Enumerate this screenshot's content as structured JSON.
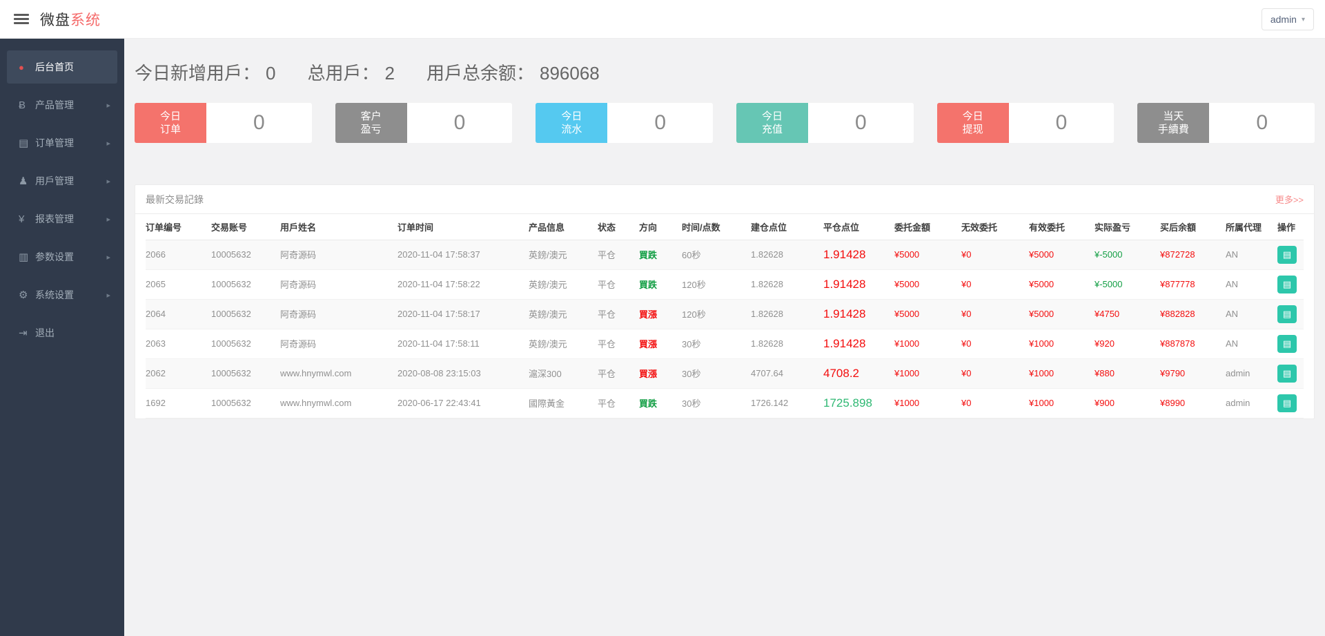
{
  "topbar": {
    "logo_black": "微盘",
    "logo_red": "系统",
    "user_menu": {
      "label": "admin",
      "caret": "▾"
    }
  },
  "sidebar": {
    "items": [
      {
        "name": "sidebar-item-dashboard",
        "icon_name": "dashboard-icon",
        "icon_glyph": "●",
        "label": "后台首页",
        "chevron": "",
        "state": "active"
      },
      {
        "name": "sidebar-item-products",
        "icon_name": "bitcoin-icon",
        "icon_glyph": "Ƀ",
        "label": "产品管理",
        "chevron": "▸"
      },
      {
        "name": "sidebar-item-orders",
        "icon_name": "files-icon",
        "icon_glyph": "▤",
        "label": "订单管理",
        "chevron": "▸"
      },
      {
        "name": "sidebar-item-users",
        "icon_name": "user-icon",
        "icon_glyph": "♟",
        "label": "用戶管理",
        "chevron": "▸"
      },
      {
        "name": "sidebar-item-reports",
        "icon_name": "yen-icon",
        "icon_glyph": "¥",
        "label": "报表管理",
        "chevron": "▸"
      },
      {
        "name": "sidebar-item-params",
        "icon_name": "copy-icon",
        "icon_glyph": "▥",
        "label": "参数设置",
        "chevron": "▸"
      },
      {
        "name": "sidebar-item-system",
        "icon_name": "gears-icon",
        "icon_glyph": "⚙",
        "label": "系统设置",
        "chevron": "▸"
      },
      {
        "name": "sidebar-item-logout",
        "icon_name": "signout-icon",
        "icon_glyph": "⇥",
        "label": "退出",
        "chevron": ""
      }
    ]
  },
  "stats": [
    {
      "label": "今日新增用戶：",
      "value": "0"
    },
    {
      "label": "总用戶：",
      "value": "2"
    },
    {
      "label": "用戶总余额：",
      "value": "896068"
    }
  ],
  "cards": [
    {
      "name": "card-today-orders",
      "label": "今日\n订单",
      "value": "0",
      "color": "#f4736c"
    },
    {
      "name": "card-client-pnl",
      "label": "客户\n盈亏",
      "value": "0",
      "color": "#8e8e8e"
    },
    {
      "name": "card-today-flow",
      "label": "今日\n流水",
      "value": "0",
      "color": "#55c9f0"
    },
    {
      "name": "card-today-deposit",
      "label": "今日\n充值",
      "value": "0",
      "color": "#66c6b4"
    },
    {
      "name": "card-today-withdraw",
      "label": "今日\n提现",
      "value": "0",
      "color": "#f4736c"
    },
    {
      "name": "card-today-fees",
      "label": "当天\n手續費",
      "value": "0",
      "color": "#8e8e8e"
    }
  ],
  "panel": {
    "title": "最新交易記錄",
    "more_label": "更多>>",
    "action_icon": "▤",
    "headers": [
      "订单编号",
      "交易账号",
      "用戶姓名",
      "订单时间",
      "产品信息",
      "状态",
      "方向",
      "时间/点数",
      "建仓点位",
      "平仓点位",
      "委托金額",
      "无效委托",
      "有效委托",
      "实际盈亏",
      "买后余額",
      "所属代理",
      "操作"
    ],
    "rows": [
      {
        "id": "2066",
        "account": "10005632",
        "name": "阿奇源码",
        "time": "2020-11-04 17:58:37",
        "product": "英鎊/澳元",
        "status": "平仓",
        "dir": "買跌",
        "dir_c": "green",
        "period": "60秒",
        "open": "1.82628",
        "close": "1.91428",
        "close_c": "red",
        "amount": "¥5000",
        "invalid": "¥0",
        "valid": "¥5000",
        "profit": "¥-5000",
        "profit_c": "green",
        "balance": "¥872728",
        "agent": "AN"
      },
      {
        "id": "2065",
        "account": "10005632",
        "name": "阿奇源码",
        "time": "2020-11-04 17:58:22",
        "product": "英鎊/澳元",
        "status": "平仓",
        "dir": "買跌",
        "dir_c": "green",
        "period": "120秒",
        "open": "1.82628",
        "close": "1.91428",
        "close_c": "red",
        "amount": "¥5000",
        "invalid": "¥0",
        "valid": "¥5000",
        "profit": "¥-5000",
        "profit_c": "green",
        "balance": "¥877778",
        "agent": "AN"
      },
      {
        "id": "2064",
        "account": "10005632",
        "name": "阿奇源码",
        "time": "2020-11-04 17:58:17",
        "product": "英鎊/澳元",
        "status": "平仓",
        "dir": "買漲",
        "dir_c": "red",
        "period": "120秒",
        "open": "1.82628",
        "close": "1.91428",
        "close_c": "red",
        "amount": "¥5000",
        "invalid": "¥0",
        "valid": "¥5000",
        "profit": "¥4750",
        "profit_c": "red",
        "balance": "¥882828",
        "agent": "AN"
      },
      {
        "id": "2063",
        "account": "10005632",
        "name": "阿奇源码",
        "time": "2020-11-04 17:58:11",
        "product": "英鎊/澳元",
        "status": "平仓",
        "dir": "買漲",
        "dir_c": "red",
        "period": "30秒",
        "open": "1.82628",
        "close": "1.91428",
        "close_c": "red",
        "amount": "¥1000",
        "invalid": "¥0",
        "valid": "¥1000",
        "profit": "¥920",
        "profit_c": "red",
        "balance": "¥887878",
        "agent": "AN"
      },
      {
        "id": "2062",
        "account": "10005632",
        "name": "www.hnymwl.com",
        "time": "2020-08-08 23:15:03",
        "product": "滬深300",
        "status": "平仓",
        "dir": "買漲",
        "dir_c": "red",
        "period": "30秒",
        "open": "4707.64",
        "close": "4708.2",
        "close_c": "red",
        "amount": "¥1000",
        "invalid": "¥0",
        "valid": "¥1000",
        "profit": "¥880",
        "profit_c": "red",
        "balance": "¥9790",
        "agent": "admin"
      },
      {
        "id": "1692",
        "account": "10005632",
        "name": "www.hnymwl.com",
        "time": "2020-06-17 22:43:41",
        "product": "國際黃金",
        "status": "平仓",
        "dir": "買跌",
        "dir_c": "green",
        "period": "30秒",
        "open": "1726.142",
        "close": "1725.898",
        "close_c": "green-bright",
        "amount": "¥1000",
        "invalid": "¥0",
        "valid": "¥1000",
        "profit": "¥900",
        "profit_c": "red",
        "balance": "¥8990",
        "agent": "admin"
      }
    ]
  }
}
